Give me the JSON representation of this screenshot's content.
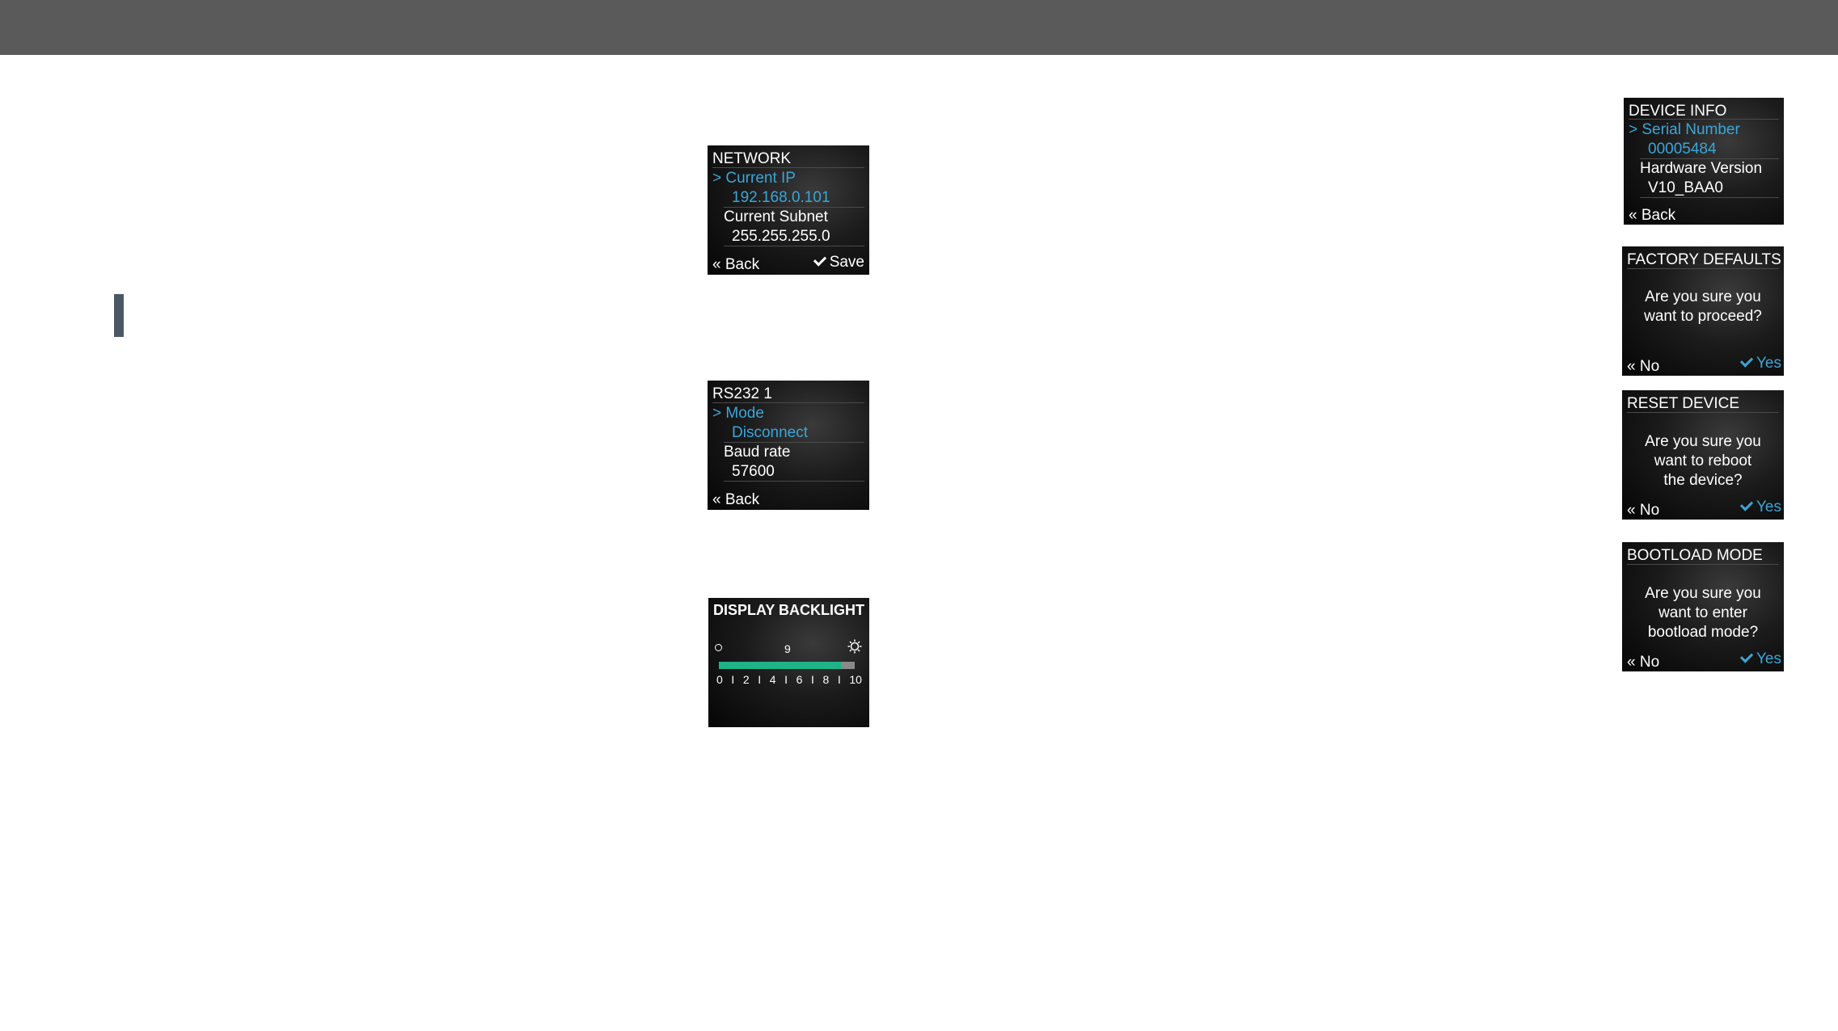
{
  "network": {
    "title": "NETWORK",
    "items": [
      {
        "label": "> Current IP",
        "value": "192.168.0.101"
      },
      {
        "label": "Current Subnet",
        "value": "255.255.255.0"
      }
    ],
    "back": "« Back",
    "save": "Save"
  },
  "rs232": {
    "title": "RS232 1",
    "items": [
      {
        "label": "> Mode",
        "value": "Disconnect"
      },
      {
        "label": "Baud rate",
        "value": "57600"
      }
    ],
    "back": "« Back"
  },
  "backlight": {
    "title": "DISPLAY BACKLIGHT",
    "value": "9",
    "level": 9,
    "max": 10,
    "ticks": [
      "0",
      "I",
      "2",
      "I",
      "4",
      "I",
      "6",
      "I",
      "8",
      "I",
      "10"
    ],
    "fill_color": "#1eb389"
  },
  "device_info": {
    "title": "DEVICE INFO",
    "items": [
      {
        "label": "> Serial Number",
        "value": "00005484"
      },
      {
        "label": "Hardware Version",
        "value": "V10_BAA0"
      }
    ],
    "back": "« Back"
  },
  "factory_defaults": {
    "title": "FACTORY DEFAULTS",
    "message": [
      "Are you sure you",
      "want to proceed?"
    ],
    "no": "« No",
    "yes": "Yes"
  },
  "reset_device": {
    "title": "RESET DEVICE",
    "message": [
      "Are you sure you",
      "want to reboot",
      "the device?"
    ],
    "no": "« No",
    "yes": "Yes"
  },
  "bootload": {
    "title": "BOOTLOAD MODE",
    "message": [
      "Are you sure you",
      "want to enter",
      "bootload mode?"
    ],
    "no": "« No",
    "yes": "Yes"
  },
  "colors": {
    "header_bar": "#5a5a5a",
    "highlight": "#3aa6d8",
    "screen_bg": "#111111"
  }
}
